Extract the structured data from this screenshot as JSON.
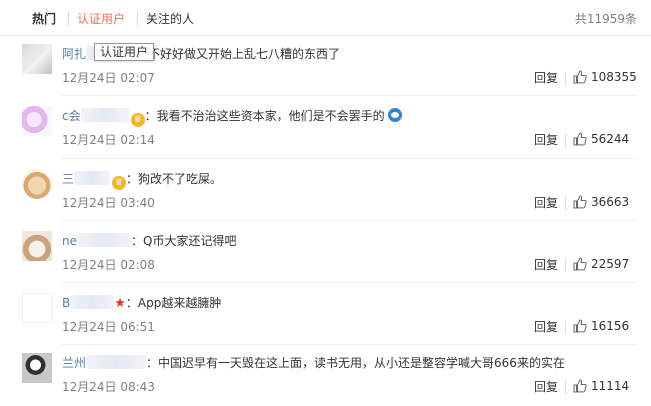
{
  "tabs": {
    "hot": "热门",
    "certified": "认证用户",
    "following": "关注的人",
    "total": "共11959条"
  },
  "tooltip": "认证用户",
  "actions": {
    "reply": "回复"
  },
  "comments": [
    {
      "username": "阿扎",
      "sep": "",
      "text": "们天软件不好好做又开始上乱七八糟的东西了",
      "time": "12月24日 02:07",
      "likes": "108355",
      "avatar": "gray-avatar"
    },
    {
      "username": "c会",
      "sep": "：",
      "text": "我看不治治这些资本家，他们是不会罢手的",
      "time": "12月24日 02:14",
      "likes": "56244",
      "avatar": "anime-avatar"
    },
    {
      "username": "三",
      "sep": "：",
      "text": "狗改不了吃屎。",
      "time": "12月24日 03:40",
      "likes": "36663",
      "avatar": "cartoon-face-avatar"
    },
    {
      "username": "ne",
      "sep": "：",
      "text": "Q币大家还记得吧",
      "time": "12月24日 02:08",
      "likes": "22597",
      "avatar": "cat-avatar"
    },
    {
      "username": "B",
      "sep": "：",
      "text": "App越来越臃肿",
      "time": "12月24日 06:51",
      "likes": "16156",
      "avatar": "blank-avatar"
    },
    {
      "username": "兰州",
      "sep": "：",
      "text": "中国迟早有一天毁在这上面，读书无用，从小还是整容学喊大哥666来的实在",
      "time": "12月24日 08:43",
      "likes": "11114",
      "avatar": "dog-avatar"
    }
  ]
}
